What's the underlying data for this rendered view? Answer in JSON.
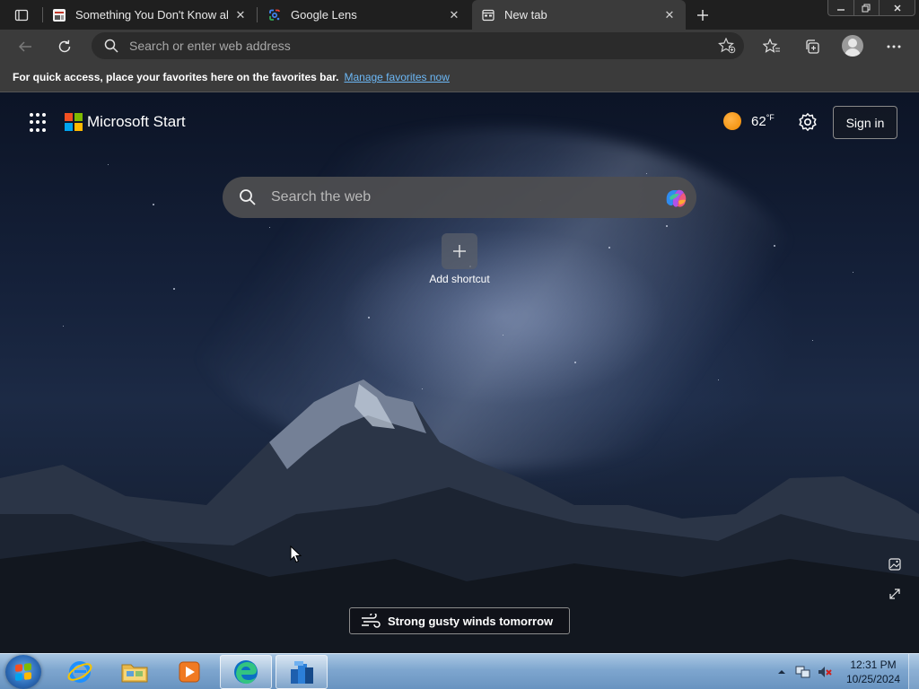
{
  "browser": {
    "tabs": [
      {
        "title": "Something You Don't Know about",
        "favicon": "article-favicon",
        "close": "✕",
        "active": false
      },
      {
        "title": "Google Lens",
        "favicon": "google-lens-icon",
        "close": "✕",
        "active": false
      },
      {
        "title": "New tab",
        "favicon": "new-tab-icon",
        "close": "✕",
        "active": true
      }
    ],
    "address_placeholder": "Search or enter web address",
    "favorites_bar": {
      "message": "For quick access, place your favorites here on the favorites bar.",
      "link": "Manage favorites now"
    }
  },
  "newtab": {
    "brand": "Microsoft Start",
    "brand_colors": [
      "#f25022",
      "#7fba00",
      "#00a4ef",
      "#ffb900"
    ],
    "weather": {
      "temp": "62",
      "unit": "°F"
    },
    "signin_label": "Sign in",
    "search_placeholder": "Search the web",
    "shortcut_label": "Add shortcut",
    "weather_alert": "Strong gusty winds tomorrow"
  },
  "taskbar": {
    "apps": [
      "internet-explorer",
      "file-explorer",
      "media-player",
      "edge",
      "app-blue-folder"
    ],
    "clock_time": "12:31 PM",
    "clock_date": "10/25/2024"
  },
  "colors": {
    "tab_bg": "#1f1f1f",
    "toolbar_bg": "#3b3b3b",
    "link": "#6cb8f6",
    "accent_sun": "#f08a00"
  }
}
